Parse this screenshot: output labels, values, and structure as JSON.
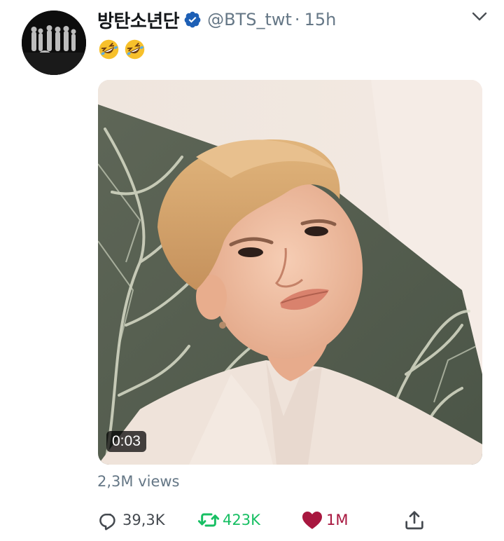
{
  "tweet": {
    "display_name": "방탄소년단",
    "handle": "@BTS_twt",
    "separator": "·",
    "time": "15h",
    "text_emojis": [
      "rolling-on-floor-laughing-emoji",
      "rolling-on-floor-laughing-emoji"
    ],
    "verified": true,
    "media": {
      "type": "video",
      "duration": "0:03"
    },
    "views": "2,3M views",
    "actions": {
      "reply_count": "39,3K",
      "retweet_count": "423K",
      "like_count": "1M"
    }
  },
  "colors": {
    "text_primary": "#14171a",
    "text_secondary": "#657786",
    "verified_blue": "#1da1f2",
    "retweet_green": "#17bf63",
    "like_red": "#e0245e"
  },
  "icons": {
    "reply": "speech-bubble-icon",
    "retweet": "retweet-arrows-icon",
    "like": "heart-icon",
    "share": "share-upload-icon",
    "menu": "chevron-down-icon",
    "verified": "verified-badge-icon"
  }
}
